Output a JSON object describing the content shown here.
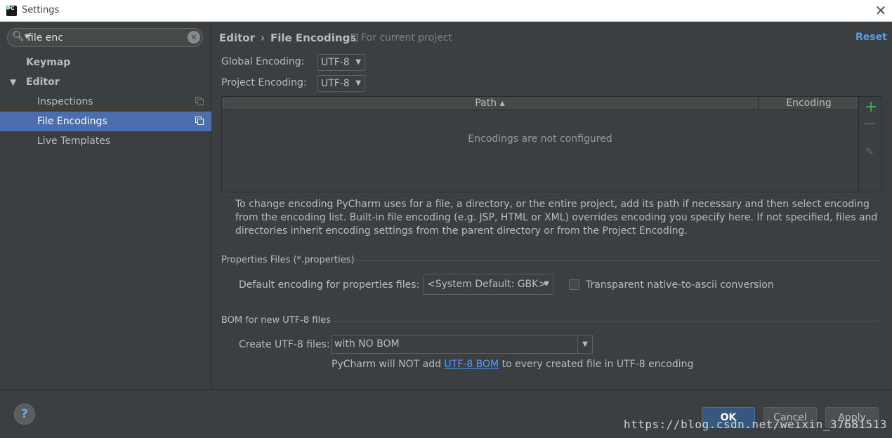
{
  "window": {
    "title": "Settings",
    "close_glyph": "✕"
  },
  "search": {
    "value": "file enc",
    "icon": "search-icon",
    "clear_icon": "clear-icon"
  },
  "sidebar": {
    "items": [
      {
        "label": "Keymap",
        "bold": true,
        "selected": false
      },
      {
        "label": "Editor",
        "bold": true,
        "expanded": true,
        "selected": false
      },
      {
        "label": "Inspections",
        "bold": false,
        "selected": false
      },
      {
        "label": "File Encodings",
        "bold": false,
        "selected": true
      },
      {
        "label": "Live Templates",
        "bold": false,
        "selected": false
      }
    ]
  },
  "header": {
    "breadcrumb_parent": "Editor",
    "breadcrumb_sep": "›",
    "breadcrumb_current": "File Encodings",
    "scope": "For current project",
    "reset_label": "Reset"
  },
  "encodings": {
    "global_label": "Global Encoding:",
    "global_value": "UTF-8",
    "project_label": "Project Encoding:",
    "project_value": "UTF-8"
  },
  "table": {
    "columns": [
      "Path ▴",
      "Encoding"
    ],
    "empty_text": "Encodings are not configured",
    "add_glyph": "+",
    "edit_glyph": "✎"
  },
  "help_text": "To change encoding PyCharm uses for a file, a directory, or the entire project, add its path if necessary and then select encoding from the encoding list. Built-in file encoding (e.g. JSP, HTML or XML) overrides encoding you specify here. If not specified, files and directories inherit encoding settings from the parent directory or from the Project Encoding.",
  "properties": {
    "section_title": "Properties Files (*.properties)",
    "default_label": "Default encoding for properties files:",
    "default_value": "<System Default: GBK>",
    "transparent_label": "Transparent native-to-ascii conversion",
    "transparent_checked": false
  },
  "bom": {
    "section_title": "BOM for new UTF-8 files",
    "create_label": "Create UTF-8 files:",
    "create_value": "with NO BOM",
    "note_prefix": "PyCharm will NOT add ",
    "note_link": "UTF-8 BOM",
    "note_suffix": " to every created file in UTF-8 encoding"
  },
  "footer": {
    "help_glyph": "?",
    "ok_label": "OK",
    "cancel_label": "Cancel",
    "apply_label": "Apply",
    "watermark": "https://blog.csdn.net/weixin_37681513"
  },
  "colors": {
    "background": "#3c3f41",
    "selection": "#4b6eaf",
    "link": "#589df6",
    "ok_button": "#365880",
    "add_green": "#4caf50"
  }
}
